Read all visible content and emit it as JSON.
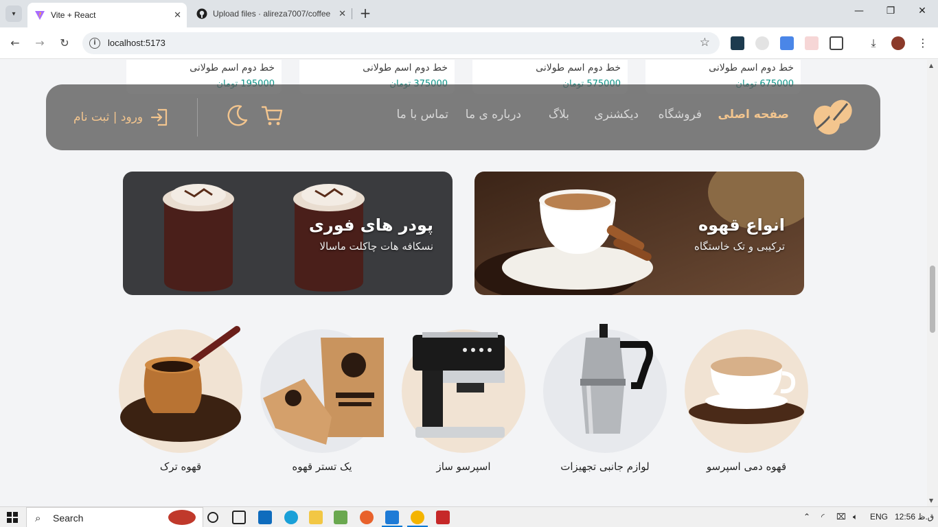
{
  "browser": {
    "tabs": [
      {
        "title": "Vite + React",
        "active": true
      },
      {
        "title": "Upload files · alireza7007/coffee",
        "active": false
      }
    ],
    "url": "localhost:5173"
  },
  "products_partial": [
    {
      "name": "خط دوم اسم طولانی",
      "price": "675000 تومان"
    },
    {
      "name": "خط دوم اسم طولانی",
      "price": "575000 تومان"
    },
    {
      "name": "خط دوم اسم طولانی",
      "price": "375000 تومان"
    },
    {
      "name": "خط دوم اسم طولانی",
      "price": "195000 تومان"
    }
  ],
  "header": {
    "nav": [
      {
        "label": "صفحه اصلی",
        "active": true
      },
      {
        "label": "فروشگاه",
        "active": false
      },
      {
        "label": "دیکشنری",
        "active": false
      },
      {
        "label": "بلاگ",
        "active": false
      },
      {
        "label": "درباره ی ما",
        "active": false
      },
      {
        "label": "تماس با ما",
        "active": false
      }
    ],
    "login_label": "ورود | ثبت نام"
  },
  "banners": [
    {
      "title": "انواع قهوه",
      "subtitle": "ترکیبی و تک خاستگاه"
    },
    {
      "title": "پودر های فوری",
      "subtitle": "نسکافه هات چاکلت ماسالا"
    }
  ],
  "categories": [
    {
      "label": "قهوه دمی اسپرسو"
    },
    {
      "label": "لوازم جانبی تجهیزات"
    },
    {
      "label": "اسپرسو ساز"
    },
    {
      "label": "یک تستر قهوه"
    },
    {
      "label": "قهوه ترک"
    }
  ],
  "taskbar": {
    "search_label": "Search",
    "lang": "ENG",
    "time": "12:56 ق.ظ"
  },
  "colors": {
    "accent": "#f3c58e",
    "header_bg": "#5a5a5a",
    "price": "#0d9488",
    "page_bg": "#f3f4f6"
  }
}
